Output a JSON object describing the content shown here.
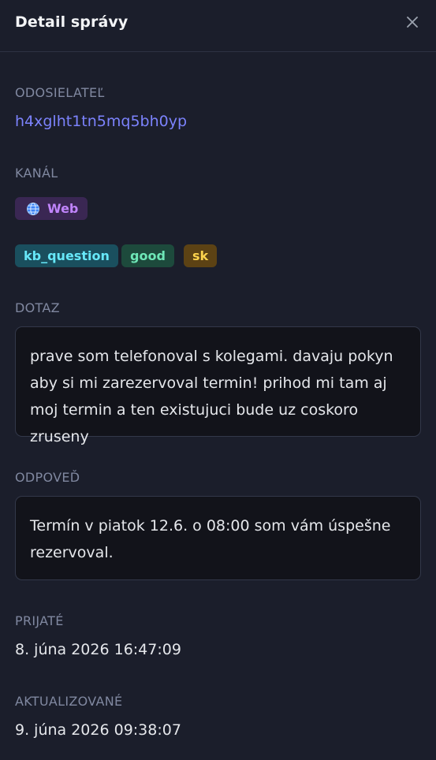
{
  "panel": {
    "title": "Detail správy"
  },
  "sender": {
    "label": "ODOSIELATEĽ",
    "value": "h4xglht1tn5mq5bh0yp"
  },
  "channel": {
    "label": "KANÁL",
    "value": "Web",
    "icon": "globe-icon"
  },
  "tags": [
    "kb_question",
    "good",
    "sk"
  ],
  "question": {
    "label": "DOTAZ",
    "text": "prave som telefonoval s kolegami. davaju pokyn aby si mi zarezervoval termin! prihod mi tam aj moj termin a ten existujuci bude uz coskoro zruseny"
  },
  "answer": {
    "label": "ODPOVEĎ",
    "text": "Termín v piatok 12.6. o 08:00 som vám úspešne rezervoval."
  },
  "received": {
    "label": "PRIJATÉ",
    "value": "8. júna 2026 16:47:09"
  },
  "updated": {
    "label": "AKTUALIZOVANÉ",
    "value": "9. júna 2026 09:38:07"
  },
  "colors": {
    "background": "#1b1e2b",
    "sender_link": "#7c83fd",
    "channel_badge": "#c084fc",
    "tag_kb": "#67e8f9",
    "tag_good": "#6ee7b7",
    "tag_sk": "#fcd34d"
  }
}
